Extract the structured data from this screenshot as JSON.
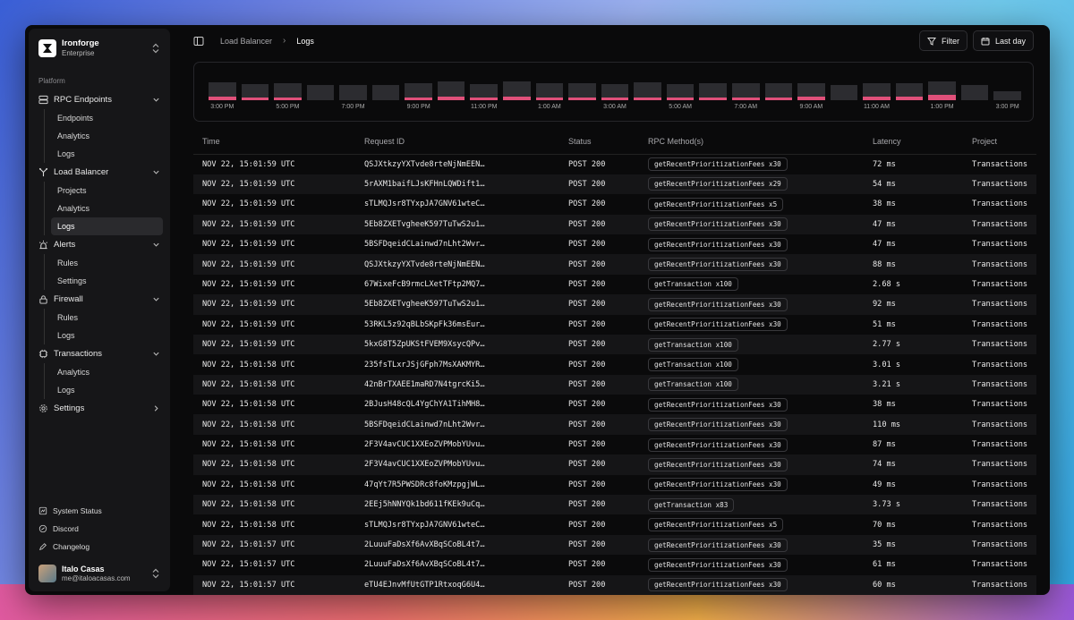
{
  "org": {
    "name": "Ironforge",
    "plan": "Enterprise"
  },
  "sidebar": {
    "section": "Platform",
    "groups": [
      {
        "label": "RPC Endpoints",
        "icon": "server-icon",
        "items": [
          "Endpoints",
          "Analytics",
          "Logs"
        ]
      },
      {
        "label": "Load Balancer",
        "icon": "split-icon",
        "items": [
          "Projects",
          "Analytics",
          "Logs"
        ],
        "active_item": "Logs"
      },
      {
        "label": "Alerts",
        "icon": "siren-icon",
        "items": [
          "Rules",
          "Settings"
        ]
      },
      {
        "label": "Firewall",
        "icon": "lock-icon",
        "items": [
          "Rules",
          "Logs"
        ]
      },
      {
        "label": "Transactions",
        "icon": "chip-icon",
        "items": [
          "Analytics",
          "Logs"
        ]
      },
      {
        "label": "Settings",
        "icon": "gear-icon",
        "items": []
      }
    ],
    "footer": [
      {
        "label": "System Status",
        "icon": "status-icon"
      },
      {
        "label": "Discord",
        "icon": "discord-icon"
      },
      {
        "label": "Changelog",
        "icon": "pen-icon"
      }
    ],
    "user": {
      "name": "Italo Casas",
      "email": "me@italoacasas.com"
    }
  },
  "breadcrumb": {
    "parent": "Load Balancer",
    "current": "Logs"
  },
  "toolbar": {
    "filter_label": "Filter",
    "range_label": "Last day"
  },
  "histogram": {
    "bars": [
      {
        "total": 0.85,
        "fill": 0.2
      },
      {
        "total": 0.75,
        "fill": 0.12
      },
      {
        "total": 0.8,
        "fill": 0.15
      },
      {
        "total": 0.72,
        "fill": 0
      },
      {
        "total": 0.72,
        "fill": 0
      },
      {
        "total": 0.72,
        "fill": 0
      },
      {
        "total": 0.8,
        "fill": 0.15
      },
      {
        "total": 0.9,
        "fill": 0.2
      },
      {
        "total": 0.75,
        "fill": 0.1
      },
      {
        "total": 0.9,
        "fill": 0.2
      },
      {
        "total": 0.8,
        "fill": 0.15
      },
      {
        "total": 0.8,
        "fill": 0.15
      },
      {
        "total": 0.75,
        "fill": 0.1
      },
      {
        "total": 0.85,
        "fill": 0.15
      },
      {
        "total": 0.75,
        "fill": 0.1
      },
      {
        "total": 0.82,
        "fill": 0.15
      },
      {
        "total": 0.82,
        "fill": 0.15
      },
      {
        "total": 0.8,
        "fill": 0.1
      },
      {
        "total": 0.82,
        "fill": 0.2
      },
      {
        "total": 0.72,
        "fill": 0
      },
      {
        "total": 0.82,
        "fill": 0.2
      },
      {
        "total": 0.82,
        "fill": 0.2
      },
      {
        "total": 0.88,
        "fill": 0.25
      },
      {
        "total": 0.72,
        "fill": 0
      },
      {
        "total": 0.45,
        "fill": 0
      }
    ],
    "labels": [
      "3:00 PM",
      "5:00 PM",
      "7:00 PM",
      "9:00 PM",
      "11:00 PM",
      "1:00 AM",
      "3:00 AM",
      "5:00 AM",
      "7:00 AM",
      "9:00 AM",
      "11:00 AM",
      "1:00 PM",
      "3:00 PM"
    ]
  },
  "table": {
    "columns": [
      "Time",
      "Request ID",
      "Status",
      "RPC Method(s)",
      "Latency",
      "Project"
    ],
    "rows": [
      [
        "NOV 22, 15:01:59 UTC",
        "QSJXtkzyYXTvde8rteNjNmEEN…",
        "POST 200",
        "getRecentPrioritizationFees x30",
        "72 ms",
        "Transactions"
      ],
      [
        "NOV 22, 15:01:59 UTC",
        "5rAXM1baifLJsKFHnLQWDift1…",
        "POST 200",
        "getRecentPrioritizationFees x29",
        "54 ms",
        "Transactions"
      ],
      [
        "NOV 22, 15:01:59 UTC",
        "sTLMQJsr8TYxpJA7GNV61wteC…",
        "POST 200",
        "getRecentPrioritizationFees x5",
        "38 ms",
        "Transactions"
      ],
      [
        "NOV 22, 15:01:59 UTC",
        "5Eb8ZXETvgheeK597TuTwS2u1…",
        "POST 200",
        "getRecentPrioritizationFees x30",
        "47 ms",
        "Transactions"
      ],
      [
        "NOV 22, 15:01:59 UTC",
        "5BSFDqeidCLainwd7nLht2Wvr…",
        "POST 200",
        "getRecentPrioritizationFees x30",
        "47 ms",
        "Transactions"
      ],
      [
        "NOV 22, 15:01:59 UTC",
        "QSJXtkzyYXTvde8rteNjNmEEN…",
        "POST 200",
        "getRecentPrioritizationFees x30",
        "88 ms",
        "Transactions"
      ],
      [
        "NOV 22, 15:01:59 UTC",
        "67WixeFcB9rmcLXetTFtp2MQ7…",
        "POST 200",
        "getTransaction x100",
        "2.68 s",
        "Transactions"
      ],
      [
        "NOV 22, 15:01:59 UTC",
        "5Eb8ZXETvgheeK597TuTwS2u1…",
        "POST 200",
        "getRecentPrioritizationFees x30",
        "92 ms",
        "Transactions"
      ],
      [
        "NOV 22, 15:01:59 UTC",
        "53RKL5z92qBLbSKpFk36msEur…",
        "POST 200",
        "getRecentPrioritizationFees x30",
        "51 ms",
        "Transactions"
      ],
      [
        "NOV 22, 15:01:59 UTC",
        "5kxG8T5ZpUKStFVEM9XsycQPv…",
        "POST 200",
        "getTransaction x100",
        "2.77 s",
        "Transactions"
      ],
      [
        "NOV 22, 15:01:58 UTC",
        "235fsTLxrJSjGFph7MsXAKMYR…",
        "POST 200",
        "getTransaction x100",
        "3.01 s",
        "Transactions"
      ],
      [
        "NOV 22, 15:01:58 UTC",
        "42nBrTXAEE1maRD7N4tgrcKi5…",
        "POST 200",
        "getTransaction x100",
        "3.21 s",
        "Transactions"
      ],
      [
        "NOV 22, 15:01:58 UTC",
        "2BJusH48cQL4YgChYA1TihMH8…",
        "POST 200",
        "getRecentPrioritizationFees x30",
        "38 ms",
        "Transactions"
      ],
      [
        "NOV 22, 15:01:58 UTC",
        "5BSFDqeidCLainwd7nLht2Wvr…",
        "POST 200",
        "getRecentPrioritizationFees x30",
        "110 ms",
        "Transactions"
      ],
      [
        "NOV 22, 15:01:58 UTC",
        "2F3V4avCUC1XXEoZVPMobYUvu…",
        "POST 200",
        "getRecentPrioritizationFees x30",
        "87 ms",
        "Transactions"
      ],
      [
        "NOV 22, 15:01:58 UTC",
        "2F3V4avCUC1XXEoZVPMobYUvu…",
        "POST 200",
        "getRecentPrioritizationFees x30",
        "74 ms",
        "Transactions"
      ],
      [
        "NOV 22, 15:01:58 UTC",
        "47qYt7R5PWSDRc8foKMzpgjWL…",
        "POST 200",
        "getRecentPrioritizationFees x30",
        "49 ms",
        "Transactions"
      ],
      [
        "NOV 22, 15:01:58 UTC",
        "2EEj5hNNYQk1bd611fKEk9uCq…",
        "POST 200",
        "getTransaction x83",
        "3.73 s",
        "Transactions"
      ],
      [
        "NOV 22, 15:01:58 UTC",
        "sTLMQJsr8TYxpJA7GNV61wteC…",
        "POST 200",
        "getRecentPrioritizationFees x5",
        "70 ms",
        "Transactions"
      ],
      [
        "NOV 22, 15:01:57 UTC",
        "2LuuuFaDsXf6AvXBqSCoBL4t7…",
        "POST 200",
        "getRecentPrioritizationFees x30",
        "35 ms",
        "Transactions"
      ],
      [
        "NOV 22, 15:01:57 UTC",
        "2LuuuFaDsXf6AvXBqSCoBL4t7…",
        "POST 200",
        "getRecentPrioritizationFees x30",
        "61 ms",
        "Transactions"
      ],
      [
        "NOV 22, 15:01:57 UTC",
        "eTU4EJnvMfUtGTP1RtxoqG6U4…",
        "POST 200",
        "getRecentPrioritizationFees x30",
        "60 ms",
        "Transactions"
      ]
    ]
  },
  "colors": {
    "accent": "#e0507a",
    "bar": "#2c2c30",
    "bg": "#0a0a0b",
    "sidebar": "#161618"
  }
}
